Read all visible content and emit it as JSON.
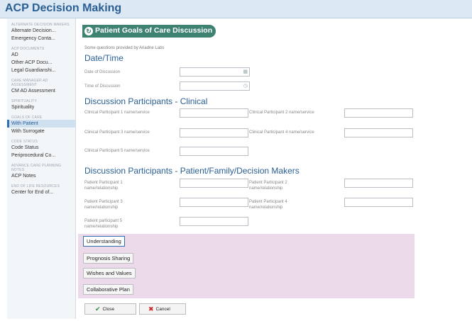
{
  "app": {
    "title": "ACP Decision Making"
  },
  "sidebar": {
    "sections": [
      {
        "heading": "ALTERNATE DECISION MAKERS",
        "items": [
          "Alternate Decision...",
          "Emergency Conta..."
        ]
      },
      {
        "heading": "ACP DOCUMENTS",
        "items": [
          "AD",
          "Other ACP Docu...",
          "Legal Guardianshi..."
        ]
      },
      {
        "heading": "CARE MANAGER AD ASSESSMENT",
        "items": [
          "CM AD Assessment"
        ]
      },
      {
        "heading": "SPIRITUALITY",
        "items": [
          "Spirituality"
        ]
      },
      {
        "heading": "GOALS OF CARE",
        "items": [
          "With Patient",
          "With Surrogate"
        ]
      },
      {
        "heading": "CODE STATUS",
        "items": [
          "Code Status",
          "Periprocedural Co..."
        ]
      },
      {
        "heading": "ADVANCE CARE PLANNING NOTES",
        "items": [
          "ACP Notes"
        ]
      },
      {
        "heading": "END OF LIFE RESOURCES",
        "items": [
          "Center for End of..."
        ]
      }
    ],
    "active_item": "With Patient"
  },
  "form": {
    "header": "Patient Goals of Care Discussion",
    "note": "Some questions provided by Ariadne Labs",
    "datetime": {
      "heading": "Date/Time",
      "date_label": "Date of Discussion",
      "time_label": "Time of Discussion",
      "date_value": "",
      "time_value": "",
      "calendar_icon": "calendar-icon",
      "clock_icon": "clock-icon"
    },
    "clinical": {
      "heading": "Discussion Participants - Clinical",
      "p1": "Clinical Participant 1 name/service",
      "p2": "Clinical Participant 2 name/service",
      "p3": "Clinical Participant 3 name/service",
      "p4": "Clinical Participant 4 name/service",
      "p5": "Clinical Participant 5 name/service"
    },
    "patient": {
      "heading": "Discussion Participants - Patient/Family/Decision Makers",
      "p1": "Patient Participant 1 name/relationship",
      "p2": "Patient Participant 2 name/relationship",
      "p3": "Patient Participant 3 name/relationship",
      "p4": "Patient Participant 4 name/relationship",
      "p5": "Patient participant 5 name/relationship"
    },
    "tabs": [
      "Understanding",
      "Prognosis Sharing",
      "Wishes and Values",
      "Collaborative Plan"
    ],
    "active_tab": "Understanding",
    "buttons": {
      "close_label": "Close",
      "cancel_label": "Cancel",
      "close_icon": "check-icon",
      "cancel_icon": "x-icon"
    }
  },
  "colors": {
    "title_blue": "#2a5f93",
    "header_green": "#3e8271",
    "tab_area_pink": "#ecd9ea",
    "check_green": "#2e8b3a",
    "cancel_red": "#c62828"
  }
}
